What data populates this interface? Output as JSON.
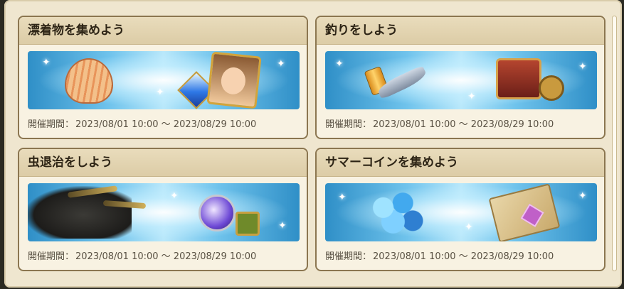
{
  "colors": {
    "panel_bg": "#efe6cf",
    "card_border": "#8b7650",
    "header_bg": "#e2d3b0",
    "banner_blue": "#6fc3ec"
  },
  "events": [
    {
      "title": "漂着物を集めよう",
      "period_label": "開催期間：",
      "period_value": "2023/08/01 10:00 〜 2023/08/29 10:00",
      "items": [
        "shell-icon",
        "gem-amulet-icon",
        "character-portrait"
      ]
    },
    {
      "title": "釣りをしよう",
      "period_label": "開催期間：",
      "period_value": "2023/08/01 10:00 〜 2023/08/29 10:00",
      "items": [
        "bait-can-icon",
        "fish-icon",
        "treasure-chest-icon",
        "hex-nut-icon"
      ]
    },
    {
      "title": "虫退治をしよう",
      "period_label": "開催期間：",
      "period_value": "2023/08/01 10:00 〜 2023/08/29 10:00",
      "items": [
        "beetle-image",
        "crystal-orb-icon",
        "emerald-tag-icon"
      ]
    },
    {
      "title": "サマーコインを集めよう",
      "period_label": "開催期間：",
      "period_value": "2023/08/01 10:00 〜 2023/08/29 10:00",
      "items": [
        "summer-coins-icon",
        "ancient-scroll-icon"
      ]
    }
  ]
}
